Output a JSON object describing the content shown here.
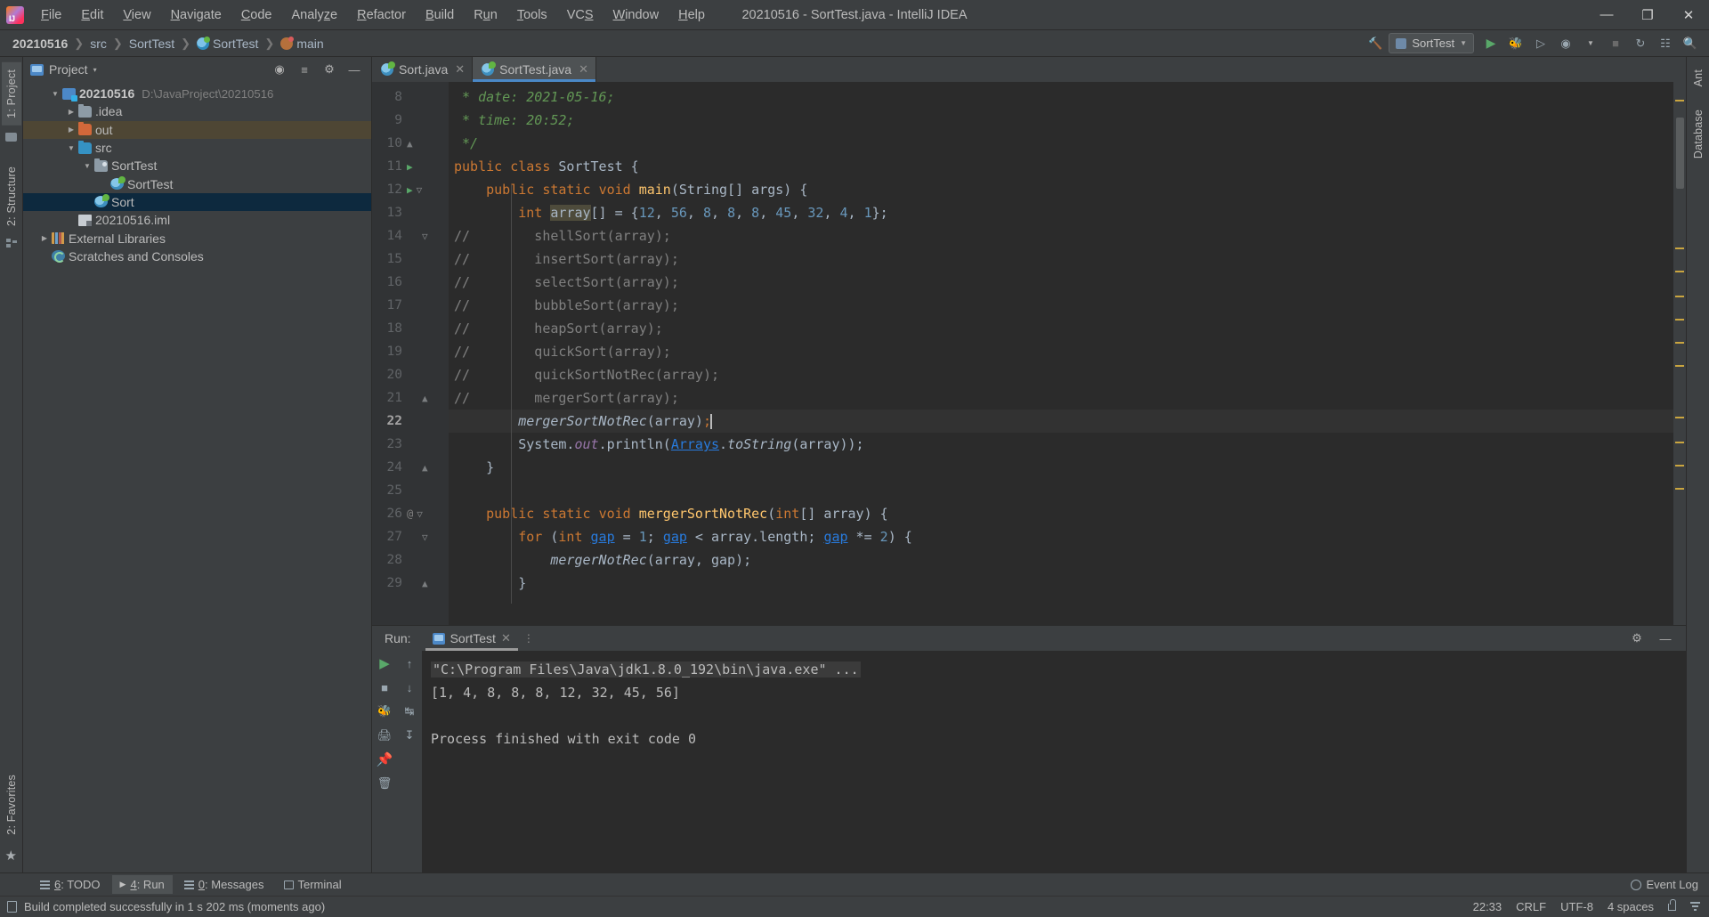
{
  "window": {
    "title": "20210516 - SortTest.java - IntelliJ IDEA",
    "minimize": "—",
    "maximize": "❐",
    "close": "✕"
  },
  "menubar": [
    {
      "label": "File"
    },
    {
      "label": "Edit"
    },
    {
      "label": "View"
    },
    {
      "label": "Navigate"
    },
    {
      "label": "Code"
    },
    {
      "label": "Analyze"
    },
    {
      "label": "Refactor"
    },
    {
      "label": "Build"
    },
    {
      "label": "Run"
    },
    {
      "label": "Tools"
    },
    {
      "label": "VCS"
    },
    {
      "label": "Window"
    },
    {
      "label": "Help"
    }
  ],
  "breadcrumbs": [
    {
      "label": "20210516",
      "icon": "none"
    },
    {
      "label": "src",
      "icon": "none"
    },
    {
      "label": "SortTest",
      "icon": "none"
    },
    {
      "label": "SortTest",
      "icon": "class-icon"
    },
    {
      "label": "main",
      "icon": "method-icon"
    }
  ],
  "toolbar": {
    "build_icon": "hammer-icon",
    "run_config": "SortTest",
    "run_icon": "run-icon",
    "debug_icon": "debug-icon",
    "coverage_icon": "run-coverage-icon",
    "profile_icon": "profiler-icon",
    "stop_icon": "stop-icon",
    "updates_icon": "update-icon",
    "layout_icon": "layout-icon",
    "search_icon": "search-icon"
  },
  "left_strip": {
    "tabs": [
      {
        "label": "1: Project",
        "active": true
      },
      {
        "label": "2: Structure",
        "active": false
      },
      {
        "label": "2: Favorites",
        "active": false
      }
    ]
  },
  "right_strip": {
    "tabs": [
      {
        "label": "Ant",
        "active": false
      },
      {
        "label": "Database",
        "active": false
      }
    ]
  },
  "project_panel": {
    "title": "Project",
    "dropdown": "▾",
    "actions": [
      "target-icon",
      "collapse-all-icon",
      "gear-icon",
      "hide-icon"
    ],
    "tree": [
      {
        "indent": 0,
        "arrow": "▼",
        "icon": "module-icon",
        "name": "20210516",
        "bold": true,
        "path": "D:\\JavaProject\\20210516",
        "state": "normal"
      },
      {
        "indent": 1,
        "arrow": "▶",
        "icon": "folder-icon",
        "name": ".idea",
        "bold": false,
        "path": "",
        "state": "normal"
      },
      {
        "indent": 1,
        "arrow": "▶",
        "icon": "folder-out-icon",
        "name": "out",
        "bold": false,
        "path": "",
        "state": "highlight"
      },
      {
        "indent": 1,
        "arrow": "▼",
        "icon": "folder-src-icon",
        "name": "src",
        "bold": false,
        "path": "",
        "state": "normal"
      },
      {
        "indent": 2,
        "arrow": "▼",
        "icon": "package-icon",
        "name": "SortTest",
        "bold": false,
        "path": "",
        "state": "normal"
      },
      {
        "indent": 3,
        "arrow": "",
        "icon": "class-icon",
        "name": "SortTest",
        "bold": false,
        "path": "",
        "state": "normal"
      },
      {
        "indent": 2,
        "arrow": "",
        "icon": "class-icon",
        "name": "Sort",
        "bold": false,
        "path": "",
        "state": "selected"
      },
      {
        "indent": 2,
        "arrow": "",
        "icon": "iml-icon",
        "name": "20210516.iml",
        "bold": false,
        "path": "",
        "state": "normal"
      },
      {
        "indent": 0,
        "arrow": "▶",
        "icon": "library-icon",
        "name": "External Libraries",
        "bold": false,
        "path": "",
        "state": "normal"
      },
      {
        "indent": 0,
        "arrow": "",
        "icon": "scratch-icon",
        "name": "Scratches and Consoles",
        "bold": false,
        "path": "",
        "state": "normal"
      }
    ]
  },
  "editor": {
    "tabs": [
      {
        "label": "Sort.java",
        "active": false,
        "icon": "java-class-icon",
        "close": "✕"
      },
      {
        "label": "SortTest.java",
        "active": true,
        "icon": "java-class-icon",
        "close": "✕"
      }
    ],
    "lines": [
      {
        "num": "8",
        "gutter": "",
        "indent": 0,
        "current": false
      },
      {
        "num": "9",
        "gutter": "",
        "indent": 0,
        "current": false
      },
      {
        "num": "10",
        "gutter": "fold",
        "indent": 0,
        "current": false
      },
      {
        "num": "11",
        "gutter": "run",
        "indent": 0,
        "current": false
      },
      {
        "num": "12",
        "gutter": "run-fold",
        "indent": 0,
        "current": false
      },
      {
        "num": "13",
        "gutter": "",
        "indent": 0,
        "current": false
      },
      {
        "num": "14",
        "gutter": "fold2",
        "indent": 0,
        "current": false
      },
      {
        "num": "15",
        "gutter": "",
        "indent": 0,
        "current": false
      },
      {
        "num": "16",
        "gutter": "",
        "indent": 0,
        "current": false
      },
      {
        "num": "17",
        "gutter": "",
        "indent": 0,
        "current": false
      },
      {
        "num": "18",
        "gutter": "",
        "indent": 0,
        "current": false
      },
      {
        "num": "19",
        "gutter": "",
        "indent": 0,
        "current": false
      },
      {
        "num": "20",
        "gutter": "",
        "indent": 0,
        "current": false
      },
      {
        "num": "21",
        "gutter": "fold",
        "indent": 0,
        "current": false
      },
      {
        "num": "22",
        "gutter": "",
        "indent": 0,
        "current": true
      },
      {
        "num": "23",
        "gutter": "",
        "indent": 0,
        "current": false
      },
      {
        "num": "24",
        "gutter": "fold",
        "indent": 0,
        "current": false
      },
      {
        "num": "25",
        "gutter": "",
        "indent": 0,
        "current": false
      },
      {
        "num": "26",
        "gutter": "at-fold",
        "indent": 0,
        "current": false
      },
      {
        "num": "27",
        "gutter": "fold2",
        "indent": 0,
        "current": false
      },
      {
        "num": "28",
        "gutter": "",
        "indent": 0,
        "current": false
      },
      {
        "num": "29",
        "gutter": "fold2",
        "indent": 0,
        "current": false
      }
    ],
    "code_lines": [
      " * date: 2021-05-16;",
      " * time: 20:52;",
      " */",
      "public class SortTest {",
      "    public static void main(String[] args) {",
      "        int array[] = {12, 56, 8, 8, 8, 45, 32, 4, 1};",
      "//        shellSort(array);",
      "//        insertSort(array);",
      "//        selectSort(array);",
      "//        bubbleSort(array);",
      "//        heapSort(array);",
      "//        quickSort(array);",
      "//        quickSortNotRec(array);",
      "//        mergerSort(array);",
      "        mergerSortNotRec(array);",
      "        System.out.println(Arrays.toString(array));",
      "    }",
      "",
      "    public static void mergerSortNotRec(int[] array) {",
      "        for (int gap = 1; gap < array.length; gap *= 2) {",
      "            mergerNotRec(array, gap);",
      "        }"
    ]
  },
  "run_panel": {
    "label": "Run:",
    "tab": "SortTest",
    "tab_close": "✕",
    "more": "⋮",
    "gear": "gear-icon",
    "minimize": "—",
    "console_lines": [
      "\"C:\\Program Files\\Java\\jdk1.8.0_192\\bin\\java.exe\" ...",
      "[1, 4, 8, 8, 8, 12, 32, 45, 56]",
      "",
      "Process finished with exit code 0"
    ],
    "gutter_icons": [
      "rerun-icon",
      "stop-icon",
      "debug-rerun-icon",
      "print-icon",
      "pin-icon",
      "trash-icon"
    ],
    "gutter2_icons": [
      "up-icon",
      "down-icon",
      "soft-wrap-icon",
      "scroll-end-icon"
    ]
  },
  "bottom_bar": {
    "items": [
      {
        "label": "6: TODO",
        "icon": "list-icon",
        "active": false
      },
      {
        "label": "4: Run",
        "icon": "play-icon",
        "active": true
      },
      {
        "label": "0: Messages",
        "icon": "list-icon",
        "active": false
      },
      {
        "label": "Terminal",
        "icon": "terminal-icon",
        "active": false
      }
    ],
    "event_log": "Event Log"
  },
  "status_bar": {
    "message": "Build completed successfully in 1 s 202 ms (moments ago)",
    "time": "22:33",
    "line_sep": "CRLF",
    "encoding": "UTF-8",
    "indent": "4 spaces",
    "lock": "lock-icon",
    "bars": "bars-icon"
  },
  "colors": {
    "accent": "#4a88c7",
    "background": "#3c3f41",
    "editor_bg": "#2b2b2b",
    "selection": "#0d293e",
    "keyword": "#cc7832",
    "string": "#6a8759",
    "number": "#6897bb",
    "comment": "#808080",
    "javadoc": "#629755",
    "method": "#ffc66d",
    "green": "#59a869"
  }
}
